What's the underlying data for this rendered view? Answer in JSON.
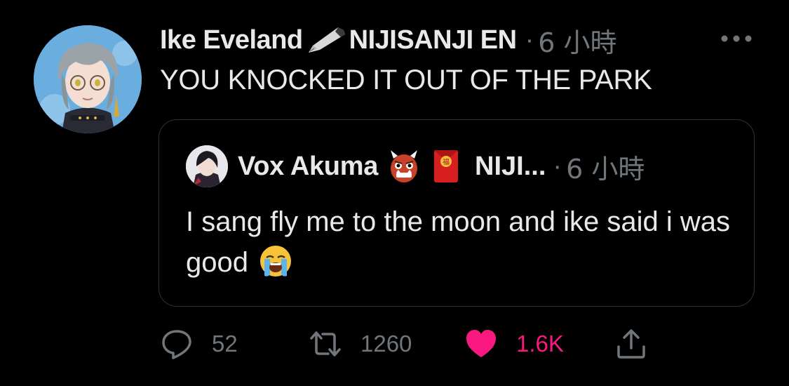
{
  "tweet": {
    "display_name": "Ike Eveland",
    "name_suffix": "NIJISANJI EN",
    "separator": "·",
    "time": "6 小時",
    "text": "YOU KNOCKED IT OUT OF THE PARK"
  },
  "quote": {
    "display_name": "Vox Akuma",
    "name_suffix": "NIJI...",
    "separator": "·",
    "time": "6 小時",
    "text": "I sang fly me to the moon and ike said i was good"
  },
  "actions": {
    "replies": "52",
    "retweets": "1260",
    "likes": "1.6K"
  },
  "colors": {
    "background": "#000000",
    "text": "#e7e9ea",
    "muted": "#71767b",
    "border": "#2f3336",
    "like_pink": "#f91880"
  },
  "icons": {
    "name_badge": "fountain-pen-icon",
    "quote_badges": [
      "ogre-face-icon",
      "red-envelope-icon"
    ],
    "quote_text_emoji": "loudly-crying-face-icon",
    "actions": [
      "reply-icon",
      "retweet-icon",
      "heart-icon",
      "share-icon"
    ],
    "more": "more-options-icon"
  }
}
